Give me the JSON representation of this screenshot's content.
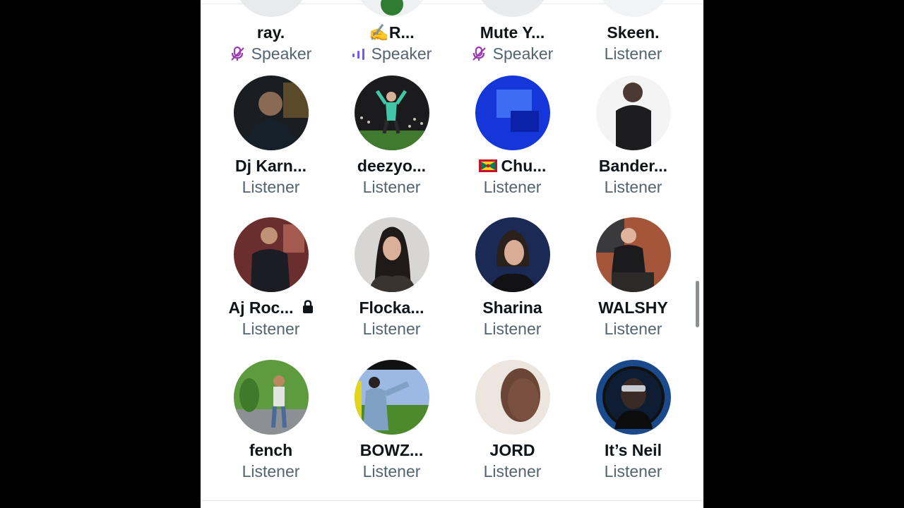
{
  "colors": {
    "background": "#000000",
    "panel": "#ffffff",
    "name_text": "#0f1419",
    "role_text": "#536471",
    "muted_icon": "#9c3ab3",
    "speaking_icon": "#7856ff"
  },
  "participants": [
    {
      "name": "ray.",
      "role": "Speaker",
      "role_icon": "mic-muted-icon"
    },
    {
      "name": "✍️R...",
      "role": "Speaker",
      "role_icon": "speaking-bars-icon"
    },
    {
      "name": "Mute Y...",
      "role": "Speaker",
      "role_icon": "mic-muted-icon"
    },
    {
      "name": "Skeen.",
      "role": "Listener"
    },
    {
      "name": "Dj Karn...",
      "role": "Listener"
    },
    {
      "name": "deezyo...",
      "role": "Listener"
    },
    {
      "name": "Chu...",
      "role": "Listener",
      "name_prefix_icon": "grenada-flag-icon"
    },
    {
      "name": "Bander...",
      "role": "Listener"
    },
    {
      "name": "Aj Roc...",
      "role": "Listener",
      "name_suffix_icon": "lock-icon"
    },
    {
      "name": "Flocka...",
      "role": "Listener"
    },
    {
      "name": "Sharina",
      "role": "Listener"
    },
    {
      "name": "WALSHY",
      "role": "Listener"
    },
    {
      "name": "fench",
      "role": "Listener"
    },
    {
      "name": "BOWZ...",
      "role": "Listener"
    },
    {
      "name": "JORD",
      "role": "Listener"
    },
    {
      "name": "It’s Neil",
      "role": "Listener"
    }
  ]
}
